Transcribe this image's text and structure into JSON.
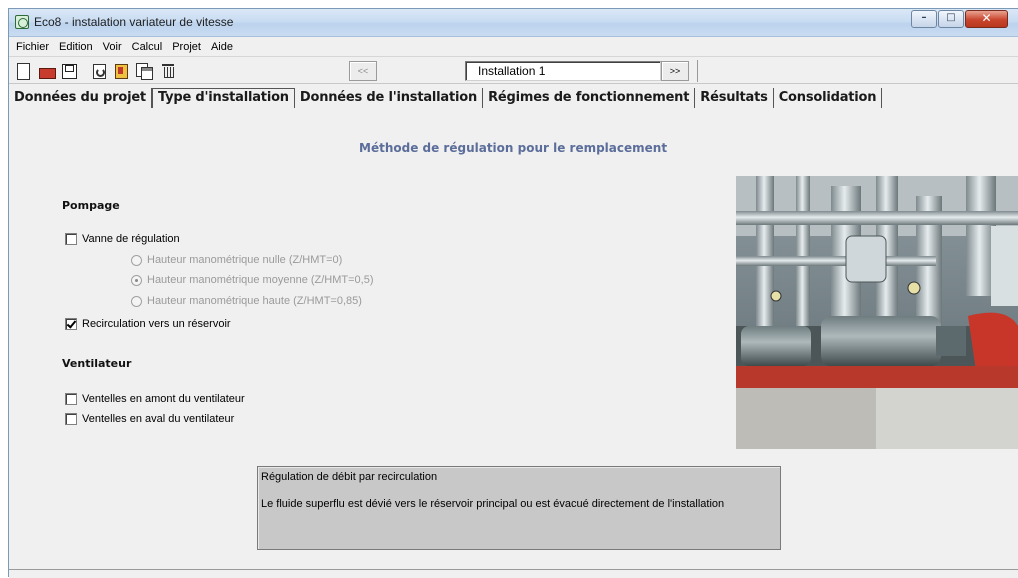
{
  "window": {
    "title": "Eco8 - instalation variateur de vitesse",
    "buttons": {
      "minimize": "–",
      "maximize": "□",
      "close": "✕"
    }
  },
  "menu": [
    "Fichier",
    "Edition",
    "Voir",
    "Calcul",
    "Projet",
    "Aide"
  ],
  "toolbar": {
    "icons": [
      "new-document-icon",
      "open-folder-icon",
      "save-icon",
      "reload-icon",
      "tools-icon",
      "copy-icon",
      "delete-icon"
    ],
    "prev_label": "<<",
    "next_label": ">>",
    "installation_value": "Installation 1"
  },
  "tabs": [
    {
      "label": "Données du projet",
      "active": false
    },
    {
      "label": "Type d'installation",
      "active": true
    },
    {
      "label": "Données de l'installation",
      "active": false
    },
    {
      "label": "Régimes de fonctionnement",
      "active": false
    },
    {
      "label": "Résultats",
      "active": false
    },
    {
      "label": "Consolidation",
      "active": false
    }
  ],
  "content": {
    "section_title": "Méthode de régulation pour le remplacement",
    "pompage": {
      "title": "Pompage",
      "vanne": {
        "label": "Vanne de régulation",
        "checked": false
      },
      "radios": [
        {
          "label": "Hauteur manométrique nulle (Z/HMT=0)",
          "selected": false
        },
        {
          "label": "Hauteur manométrique moyenne (Z/HMT=0,5)",
          "selected": true
        },
        {
          "label": "Hauteur manométrique haute (Z/HMT=0,85)",
          "selected": false
        }
      ],
      "recirculation": {
        "label": "Recirculation vers un réservoir",
        "checked": true
      }
    },
    "ventilateur": {
      "title": "Ventilateur",
      "amont": {
        "label": "Ventelles en amont du ventilateur",
        "checked": false
      },
      "aval": {
        "label": "Ventelles en aval du ventilateur",
        "checked": false
      }
    },
    "description": {
      "title": "Régulation de débit par recirculation",
      "body": "Le fluide superflu est dévié vers le réservoir principal ou est évacué directement de l'installation"
    }
  },
  "colors": {
    "section_title": "#5b6d9a",
    "description_bg": "#c8c8c8"
  }
}
